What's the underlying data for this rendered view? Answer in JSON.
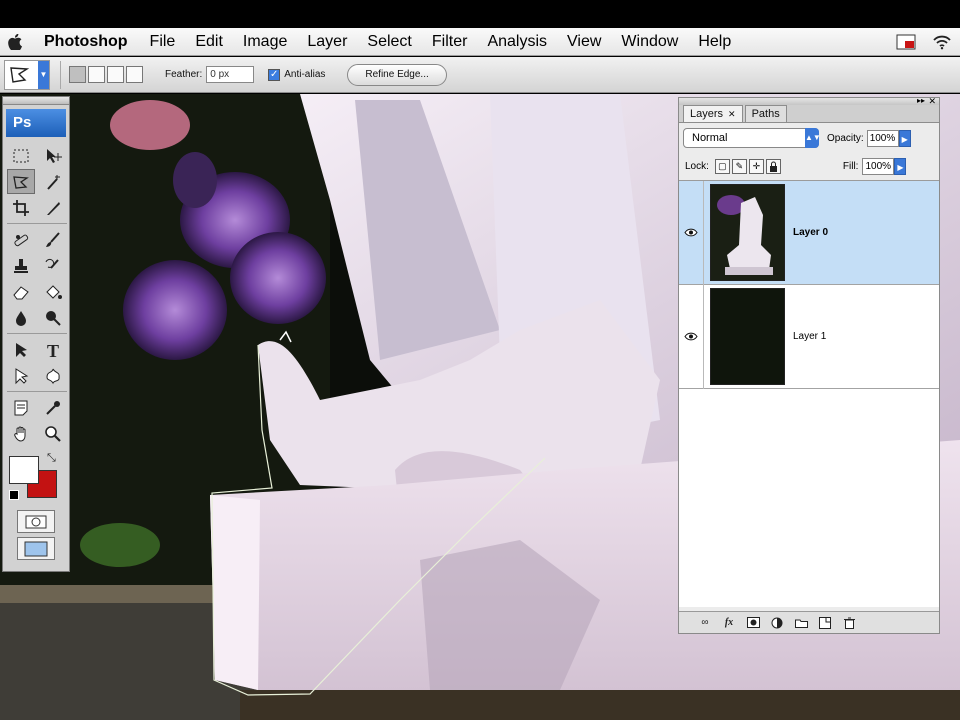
{
  "menubar": {
    "app_name": "Photoshop",
    "items": [
      "File",
      "Edit",
      "Image",
      "Layer",
      "Select",
      "Filter",
      "Analysis",
      "View",
      "Window",
      "Help"
    ]
  },
  "options_bar": {
    "feather_label": "Feather:",
    "feather_value": "0 px",
    "antialias_label": "Anti-alias",
    "antialias_checked": true,
    "refine_edge_label": "Refine Edge..."
  },
  "tools": {
    "logo": "Ps",
    "active_tool": "polygonal-lasso-icon",
    "foreground_color": "#ffffff",
    "background_color": "#c31212",
    "items": [
      "rectangular-marquee-icon",
      "move-icon",
      "polygonal-lasso-icon",
      "magic-wand-icon",
      "crop-icon",
      "slice-icon",
      "spot-healing-icon",
      "brush-icon",
      "clone-stamp-icon",
      "history-brush-icon",
      "eraser-icon",
      "paint-bucket-icon",
      "blur-icon",
      "dodge-icon",
      "path-selection-icon",
      "type-icon",
      "direct-selection-icon",
      "custom-shape-icon",
      "notes-icon",
      "eyedropper-icon",
      "hand-icon",
      "zoom-icon"
    ]
  },
  "layers_panel": {
    "tabs": [
      "Layers",
      "Paths"
    ],
    "blend_mode": "Normal",
    "opacity_label": "Opacity:",
    "opacity_value": "100%",
    "lock_label": "Lock:",
    "fill_label": "Fill:",
    "fill_value": "100%",
    "layers": [
      {
        "name": "Layer 0",
        "selected": true,
        "visible": true
      },
      {
        "name": "Layer 1",
        "selected": false,
        "visible": true
      }
    ],
    "footer_icons": [
      "link-layers-icon",
      "fx-icon",
      "layer-mask-icon",
      "adjustment-layer-icon",
      "new-group-icon",
      "new-layer-icon",
      "trash-icon"
    ]
  }
}
